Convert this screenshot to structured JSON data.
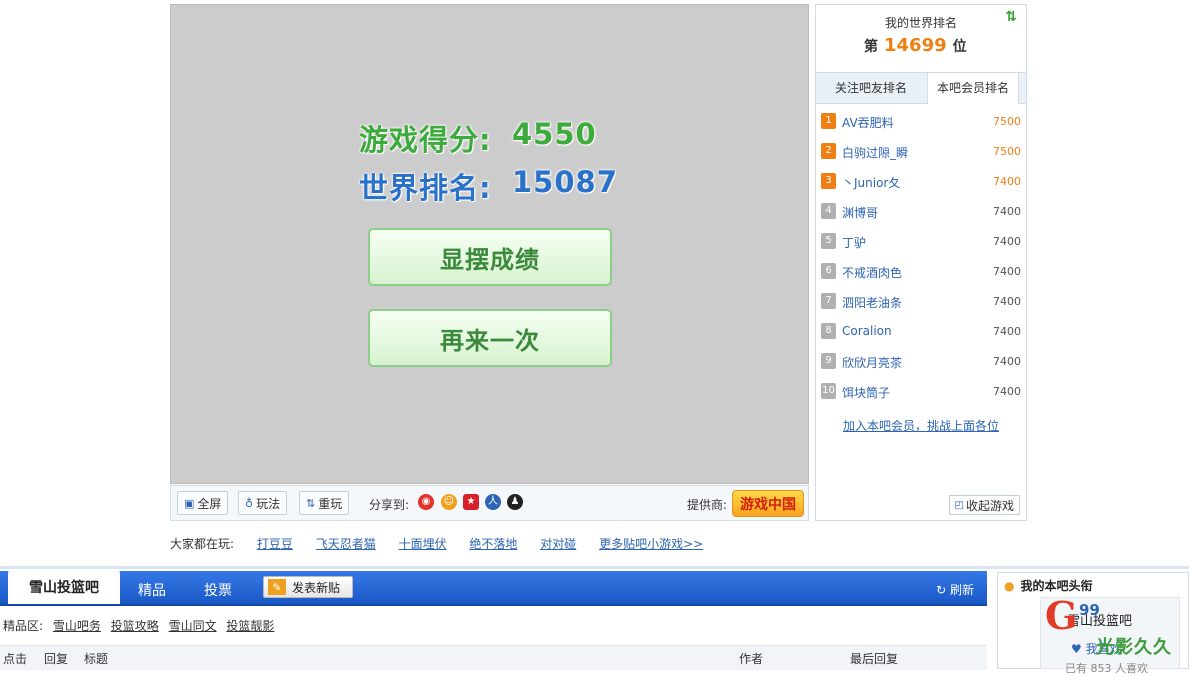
{
  "game": {
    "score_label": "游戏得分:",
    "score_value": "4550",
    "rank_label": "世界排名:",
    "rank_value": "15087",
    "show_button": "显摆成绩",
    "again_button": "再来一次"
  },
  "toolbar": {
    "fullscreen": "全屏",
    "howto": "玩法",
    "replay": "重玩",
    "share_label": "分享到:",
    "provider_label": "提供商:",
    "provider_logo": "游戏中国"
  },
  "rank_panel": {
    "title": "我的世界排名",
    "prefix": "第",
    "my_rank": "14699",
    "suffix": "位",
    "tab_friends": "关注吧友排名",
    "tab_members": "本吧会员排名",
    "rows": [
      {
        "no": "1",
        "name": "AV吞肥料",
        "score": "7500"
      },
      {
        "no": "2",
        "name": "白驹过隙_瞬",
        "score": "7500"
      },
      {
        "no": "3",
        "name": "丶Junior夂",
        "score": "7400"
      },
      {
        "no": "4",
        "name": "渊博哥",
        "score": "7400"
      },
      {
        "no": "5",
        "name": "丁驴",
        "score": "7400"
      },
      {
        "no": "6",
        "name": "不戒酒肉色",
        "score": "7400"
      },
      {
        "no": "7",
        "name": "泗阳老油条",
        "score": "7400"
      },
      {
        "no": "8",
        "name": "Coralion",
        "score": "7400"
      },
      {
        "no": "9",
        "name": "欣欣月亮茶",
        "score": "7400"
      },
      {
        "no": "10",
        "name": "饵块筒子",
        "score": "7400"
      }
    ],
    "join_link": "加入本吧会员，挑战上面各位",
    "collapse": "收起游戏"
  },
  "playing": {
    "label": "大家都在玩:",
    "games": [
      "打豆豆",
      "飞天忍者猫",
      "十面埋伏",
      "绝不落地",
      "对对碰",
      "更多贴吧小游戏>>"
    ]
  },
  "forum": {
    "tab_home": "雪山投篮吧",
    "tab_good": "精品",
    "tab_vote": "投票",
    "new_post": "发表新贴",
    "refresh": "刷新",
    "quality_label": "精品区:",
    "quality_links": [
      "雪山吧务",
      "投篮攻略",
      "雪山同文",
      "投篮靓影"
    ],
    "col_clicks": "点击",
    "col_replies": "回复",
    "col_title": "标题",
    "col_author": "作者",
    "col_last": "最后回复"
  },
  "headline": {
    "title": "我的本吧头衔",
    "forum_name": "雪山投篮吧",
    "like": "我喜欢",
    "count": "已有 853 人喜欢",
    "watermark_g": "G",
    "watermark_99": "99",
    "watermark_text": "光影久久"
  },
  "colors": {
    "accent_blue": "#1a58c6",
    "score_green": "#3cab3c",
    "rank_blue": "#2a71c9",
    "highlight_orange": "#f07f13"
  }
}
